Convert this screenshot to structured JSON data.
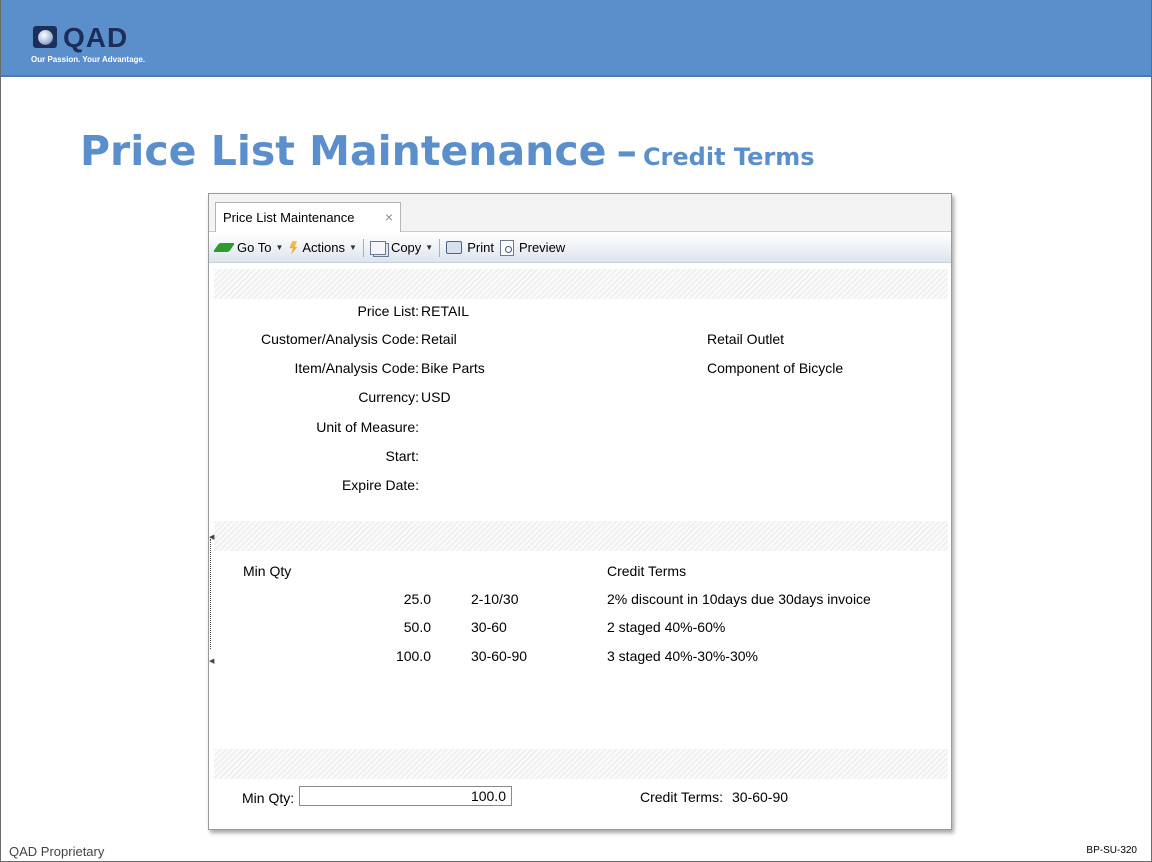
{
  "brand": {
    "logo_text": "QAD",
    "tagline": "Our Passion. Your Advantage."
  },
  "slide": {
    "title_main": "Price List Maintenance",
    "title_dash": "–",
    "title_sub": "Credit Terms",
    "footer_left": "QAD Proprietary",
    "footer_right": "BP-SU-320"
  },
  "window": {
    "tab_label": "Price List Maintenance",
    "tab_close": "×",
    "toolbar": {
      "goto": "Go To",
      "actions": "Actions",
      "copy": "Copy",
      "print": "Print",
      "preview": "Preview"
    }
  },
  "header_fields": [
    {
      "label": "Price List:",
      "value": "RETAIL",
      "desc": ""
    },
    {
      "label": "Customer/Analysis Code:",
      "value": "Retail",
      "desc": "Retail Outlet"
    },
    {
      "label": "Item/Analysis Code:",
      "value": "Bike Parts",
      "desc": "Component of Bicycle"
    },
    {
      "label": "Currency:",
      "value": "USD",
      "desc": ""
    },
    {
      "label": "Unit of Measure:",
      "value": "",
      "desc": ""
    },
    {
      "label": "Start:",
      "value": "",
      "desc": ""
    },
    {
      "label": "Expire Date:",
      "value": "",
      "desc": ""
    }
  ],
  "grid": {
    "col_min_qty": "Min Qty",
    "col_credit_terms": "Credit Terms",
    "rows": [
      {
        "qty": "25.0",
        "code": "2-10/30",
        "desc": "2% discount in 10days due 30days invoice"
      },
      {
        "qty": "50.0",
        "code": "30-60",
        "desc": "2 staged 40%-60%"
      },
      {
        "qty": "100.0",
        "code": "30-60-90",
        "desc": "3 staged 40%-30%-30%"
      }
    ]
  },
  "detail": {
    "min_qty_label": "Min Qty:",
    "min_qty_value": "100.0",
    "credit_terms_label": "Credit Terms:",
    "credit_terms_value": "30-60-90"
  }
}
